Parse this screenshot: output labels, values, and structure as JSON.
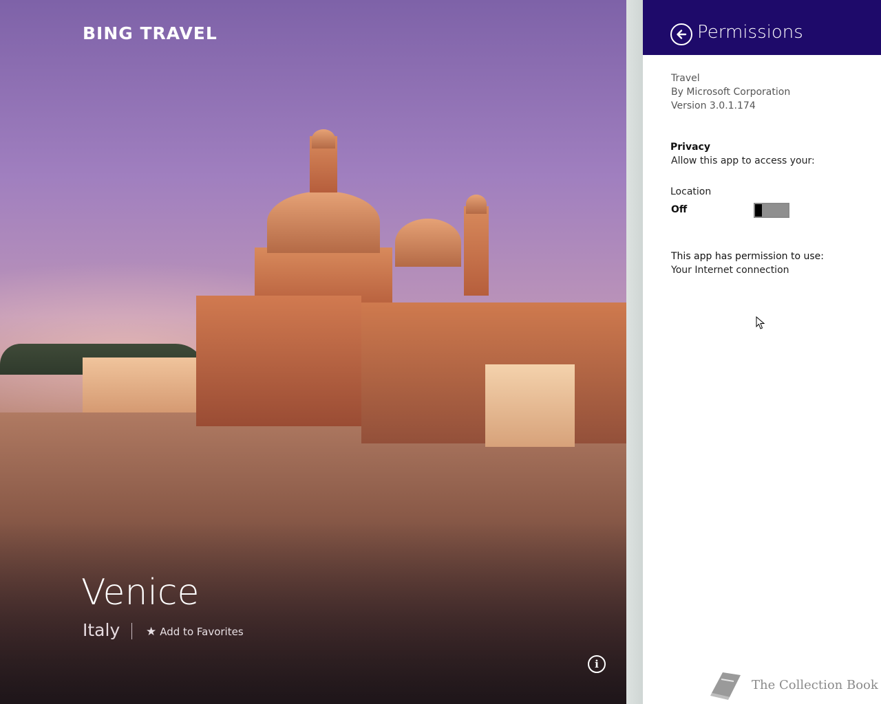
{
  "app": {
    "brand": "BING TRAVEL"
  },
  "destination": {
    "city": "Venice",
    "country": "Italy",
    "favorites_label": "Add to Favorites",
    "info_glyph": "i"
  },
  "permissions_pane": {
    "title": "Permissions",
    "app_name": "Travel",
    "publisher": "By Microsoft Corporation",
    "version": "Version 3.0.1.174",
    "privacy_heading": "Privacy",
    "privacy_subtext": "Allow this app to access your:",
    "location_label": "Location",
    "location_state": "Off",
    "location_enabled": false,
    "permissions_heading": "This app has permission to use:",
    "permissions": [
      "Your Internet connection"
    ]
  },
  "watermark": {
    "text": "The Collection Book"
  },
  "colors": {
    "header_bg": "#1e0a6a",
    "pane_bg": "#ffffff",
    "toggle_off": "#8f8f8f"
  },
  "icons": {
    "back": "back-arrow-circle-icon",
    "favorite": "star-icon",
    "info": "info-circle-icon",
    "watermark": "book-icon"
  }
}
